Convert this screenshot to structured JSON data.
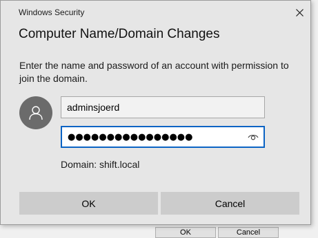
{
  "window": {
    "title": "Windows Security",
    "close_icon": "close-icon"
  },
  "dialog": {
    "heading": "Computer Name/Domain Changes",
    "instructions": "Enter the name and password of an account with permission to join the domain.",
    "avatar_icon": "user-icon",
    "username_value": "adminsjoerd",
    "password_value": "●●●●●●●●●●●●●●●●",
    "reveal_icon": "eye-icon",
    "domain_text": "Domain: shift.local",
    "ok_label": "OK",
    "cancel_label": "Cancel"
  },
  "background": {
    "ok_label": "OK",
    "cancel_label": "Cancel"
  },
  "colors": {
    "dialog_bg": "#e6e6e6",
    "focus_border": "#0a63c4",
    "avatar_bg": "#6b6b6b",
    "button_bg": "#cccccc"
  }
}
